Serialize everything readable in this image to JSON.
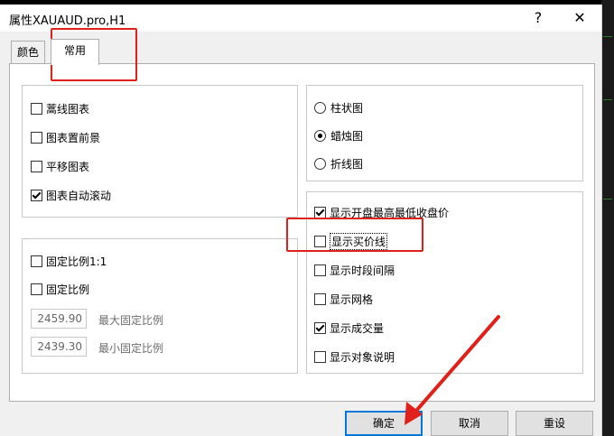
{
  "window": {
    "title": "属性XAUAUD.pro,H1",
    "help_symbol": "?",
    "close_symbol": "✕"
  },
  "tabs": [
    {
      "label": "颜色",
      "active": false
    },
    {
      "label": "常用",
      "active": true
    }
  ],
  "left_top_group": [
    {
      "label": "蒿线图表",
      "checked": false
    },
    {
      "label": "图表置前景",
      "checked": false
    },
    {
      "label": "平移图表",
      "checked": false
    },
    {
      "label": "图表自动滚动",
      "checked": true
    }
  ],
  "scale_group": {
    "fixed_ratio_1_1": {
      "label": "固定比例1:1",
      "checked": false
    },
    "fixed_ratio": {
      "label": "固定比例",
      "checked": false
    },
    "max": {
      "value": "2459.90",
      "label": "最大固定比例"
    },
    "min": {
      "value": "2439.30",
      "label": "最小固定比例"
    }
  },
  "chart_type_group": [
    {
      "label": "柱状图",
      "selected": false
    },
    {
      "label": "蜡烛图",
      "selected": true
    },
    {
      "label": "折线图",
      "selected": false
    }
  ],
  "display_group": [
    {
      "label": "显示开盘最高最低收盘价",
      "checked": true
    },
    {
      "label": "显示买价线",
      "checked": false
    },
    {
      "label": "显示时段间隔",
      "checked": false
    },
    {
      "label": "显示网格",
      "checked": false
    },
    {
      "label": "显示成交量",
      "checked": true
    },
    {
      "label": "显示对象说明",
      "checked": false
    }
  ],
  "buttons": {
    "ok": "确定",
    "cancel": "取消",
    "reset": "重设"
  },
  "colors": {
    "annotation_red": "#e0201a",
    "default_button_border": "#0078d7"
  }
}
